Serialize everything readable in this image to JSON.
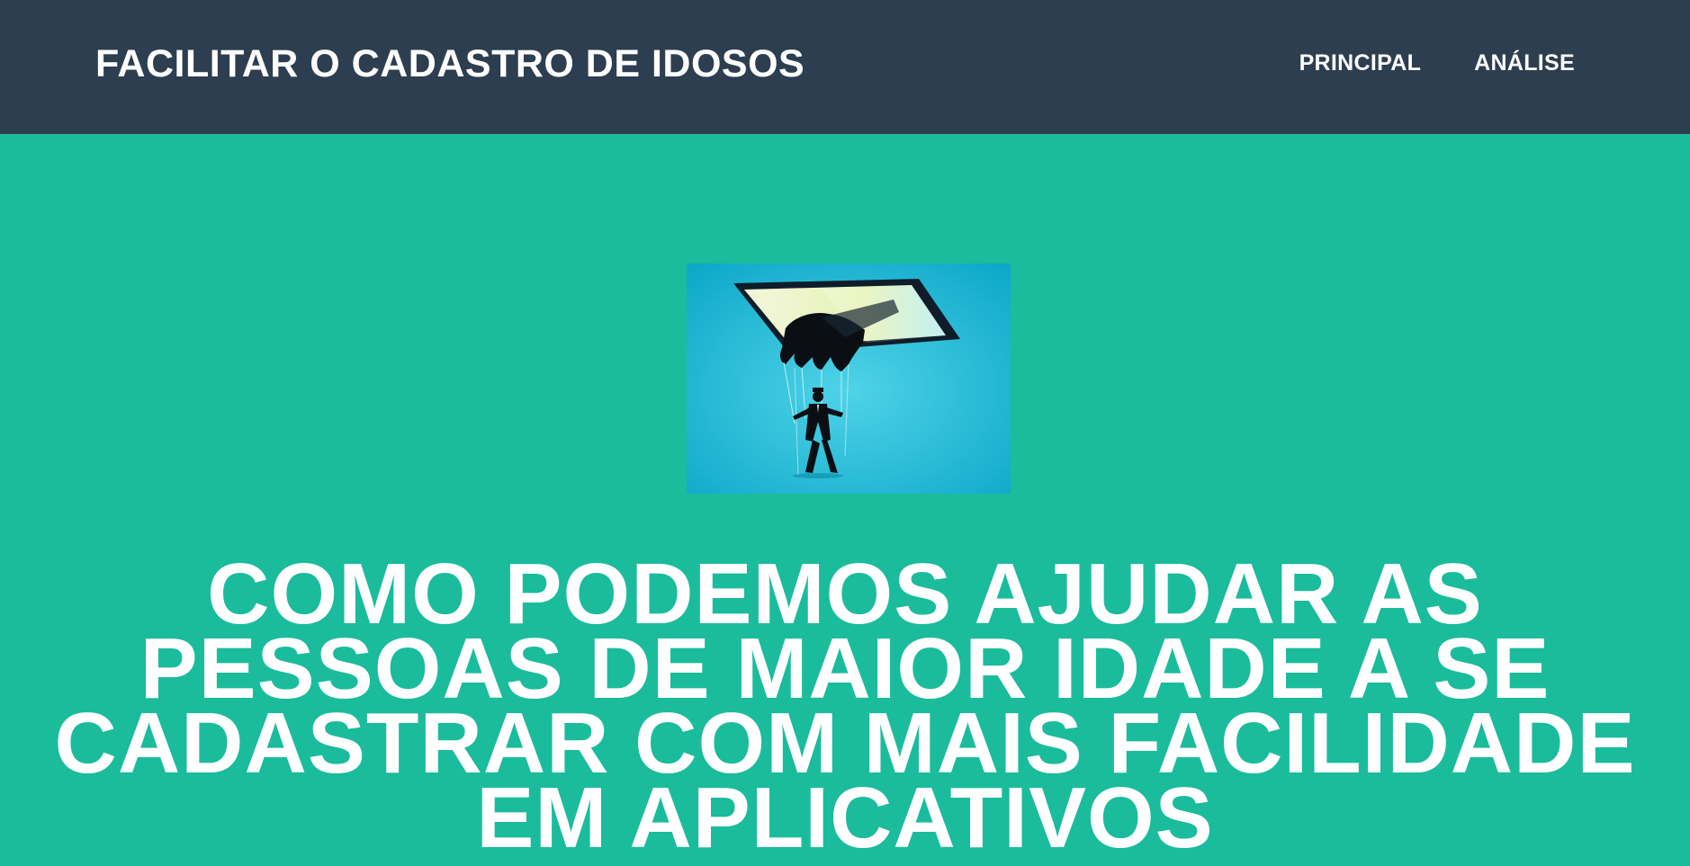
{
  "navbar": {
    "brand": "FACILITAR O CADASTRO DE IDOSOS",
    "links": [
      {
        "label": "PRINCIPAL"
      },
      {
        "label": "ANÁLISE"
      }
    ]
  },
  "hero": {
    "image_alt_icon": "puppet-hand-phone-illustration",
    "title": "COMO PODEMOS AJUDAR AS PESSOAS DE MAIOR IDADE A SE CADASTRAR COM MAIS FACILIDADE EM APLICATIVOS"
  },
  "colors": {
    "navbar_bg": "#2c3e50",
    "hero_bg": "#1abc9c",
    "text": "#ffffff"
  }
}
